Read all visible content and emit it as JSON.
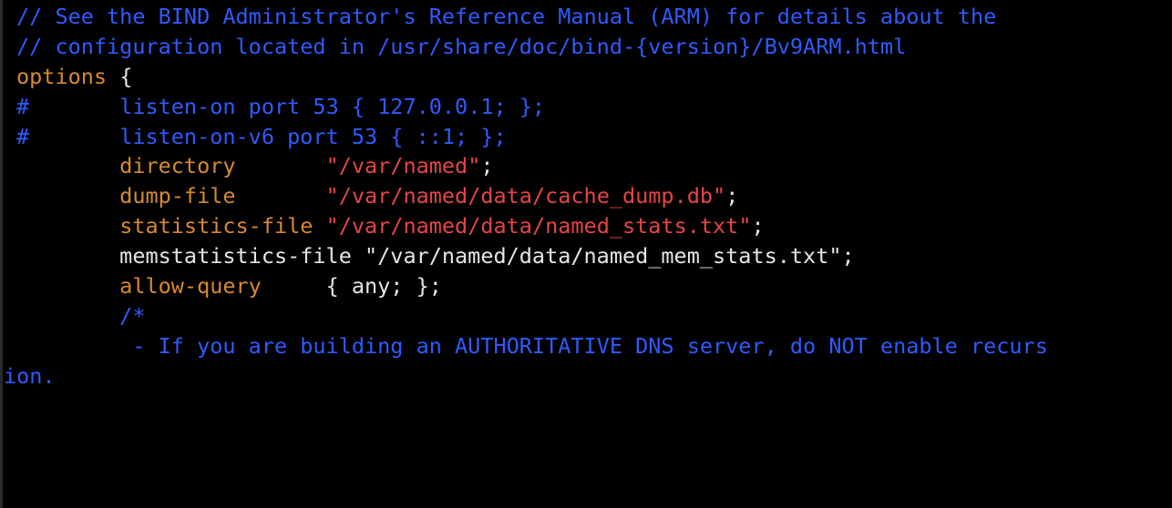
{
  "code": {
    "comment1": "// See the BIND Administrator's Reference Manual (ARM) for details about the",
    "comment2": "// configuration located in /usr/share/doc/bind-{version}/Bv9ARM.html",
    "blank1": "",
    "options_kw": "options",
    "options_brace": " {",
    "hash1": "#",
    "listen_on": "       listen-on port 53 { 127.0.0.1; };",
    "hash2": "#",
    "listen_on_v6": "       listen-on-v6 port 53 { ::1; };",
    "indent": "        ",
    "directory_kw": "directory",
    "directory_pad": "       ",
    "directory_val": "\"/var/named\"",
    "dumpfile_kw": "dump-file",
    "dumpfile_pad": "       ",
    "dumpfile_val": "\"/var/named/data/cache_dump.db\"",
    "statsfile_kw": "statistics-file",
    "statsfile_pad": " ",
    "statsfile_val": "\"/var/named/data/named_stats.txt\"",
    "memstats_line": "        memstatistics-file \"/var/named/data/named_mem_stats.txt\";",
    "allowquery_kw": "allow-query",
    "allowquery_rest": "     { any; };",
    "blank2": "",
    "blockcomment_open": "        /*",
    "blockcomment_line": "         - If you are building an AUTHORITATIVE DNS server, do NOT enable recurs",
    "ion_frag": "ion."
  }
}
